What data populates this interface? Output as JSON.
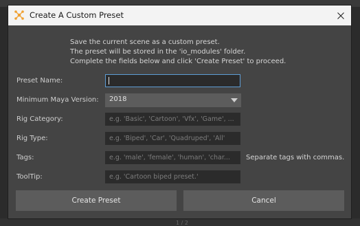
{
  "window": {
    "title": "Create A Custom Preset",
    "icon": "preset-logo-icon",
    "close_icon": "close-icon"
  },
  "intro_lines": [
    "Save the current scene as a custom preset.",
    "The preset will be stored in the 'io_modules' folder.",
    "Complete the fields below and click 'Create Preset' to proceed."
  ],
  "form": {
    "preset_name": {
      "label": "Preset Name:",
      "value": ""
    },
    "min_maya_version": {
      "label": "Minimum Maya Version:",
      "value": "2018"
    },
    "rig_category": {
      "label": "Rig Category:",
      "placeholder": "e.g. 'Basic', 'Cartoon', 'Vfx', 'Game', ..."
    },
    "rig_type": {
      "label": "Rig Type:",
      "placeholder": "e.g. 'Biped', 'Car', 'Quadruped', 'All'"
    },
    "tags": {
      "label": "Tags:",
      "placeholder": "e.g. 'male', 'female', 'human', 'char...",
      "hint": "Separate tags with commas."
    },
    "tooltip": {
      "label": "ToolTip:",
      "placeholder": "e.g. 'Cartoon biped preset.'"
    }
  },
  "buttons": {
    "create": "Create Preset",
    "cancel": "Cancel"
  },
  "background_text": "1 / 2",
  "colors": {
    "accent": "#5e9ed6",
    "dialog_bg": "#444444",
    "field_bg": "#2b2b2b",
    "button_bg": "#5c5c5c",
    "title_bg": "#f3f3f3"
  }
}
